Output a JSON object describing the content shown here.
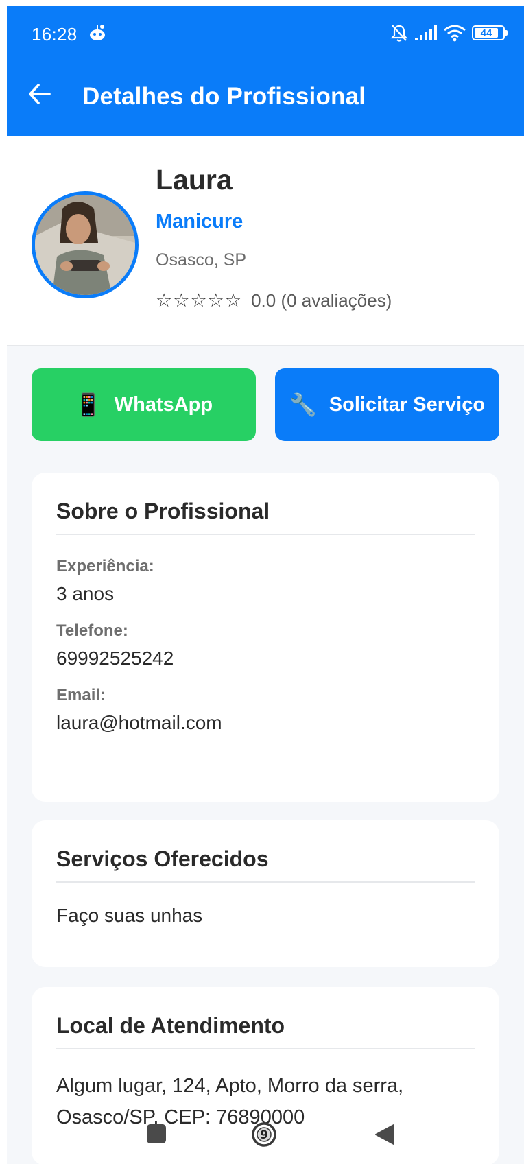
{
  "status_bar": {
    "time": "16:28",
    "battery": "44",
    "icons": [
      "notifications-off-icon",
      "signal-icon",
      "wifi-icon",
      "battery-icon"
    ]
  },
  "app_bar": {
    "title": "Detalhes do Profissional",
    "back_icon": "arrow-left-icon"
  },
  "profile": {
    "name": "Laura",
    "role": "Manicure",
    "location": "Osasco, SP",
    "stars": [
      "☆",
      "☆",
      "☆",
      "☆",
      "☆"
    ],
    "rating_text": "0.0 (0 avaliações)"
  },
  "actions": {
    "whatsapp_icon": "📱",
    "whatsapp_label": "WhatsApp",
    "request_icon": "🔧",
    "request_label": "Solicitar Serviço"
  },
  "about": {
    "title": "Sobre o Profissional",
    "experience_label": "Experiência:",
    "experience_value": "3 anos",
    "phone_label": "Telefone:",
    "phone_value": "69992525242",
    "email_label": "Email:",
    "email_value": "laura@hotmail.com"
  },
  "services": {
    "title": "Serviços Oferecidos",
    "description": "Faço suas unhas"
  },
  "location": {
    "title": "Local de Atendimento",
    "address": "Algum lugar, 124, Apto, Morro da serra, Osasco/SP, CEP: 76890000"
  },
  "nav_bar": {
    "home_badge": "9"
  },
  "colors": {
    "primary": "#0a7cf9",
    "whatsapp": "#27d064",
    "background": "#f5f7fa"
  }
}
